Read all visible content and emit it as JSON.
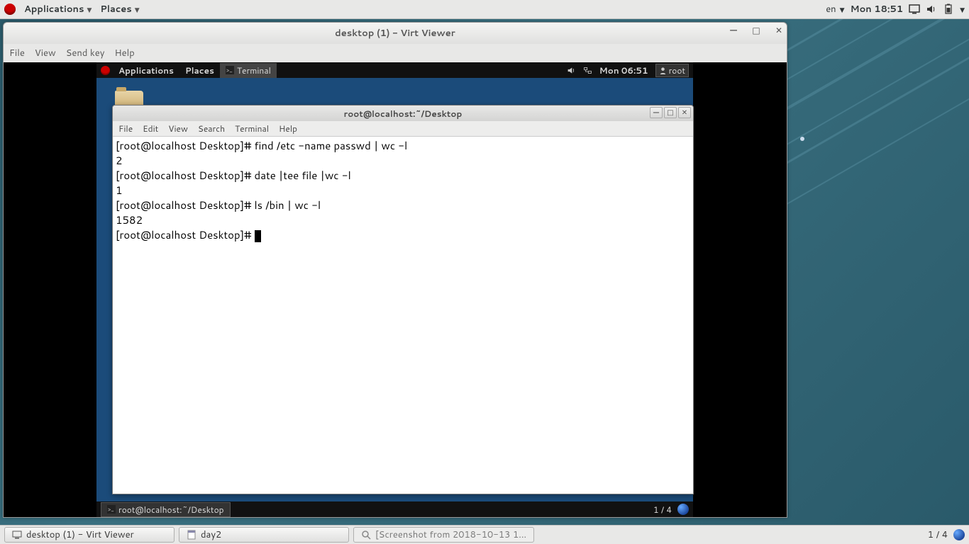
{
  "outer_panel": {
    "applications": "Applications",
    "places": "Places",
    "lang": "en",
    "datetime": "Mon 18:51"
  },
  "virt_viewer": {
    "title": "desktop (1) - Virt Viewer",
    "menu": {
      "file": "File",
      "view": "View",
      "sendkey": "Send key",
      "help": "Help"
    }
  },
  "inner_panel": {
    "applications": "Applications",
    "places": "Places",
    "terminal_tab": "Terminal",
    "datetime": "Mon 06:51",
    "user": "root"
  },
  "terminal": {
    "title": "root@localhost:~/Desktop",
    "menu": {
      "file": "File",
      "edit": "Edit",
      "view": "View",
      "search": "Search",
      "terminal": "Terminal",
      "help": "Help"
    },
    "lines": [
      "[root@localhost Desktop]# find /etc -name passwd | wc -l",
      "2",
      "[root@localhost Desktop]# date |tee file |wc -l",
      "1",
      "[root@localhost Desktop]# ls /bin | wc -l",
      "1582",
      "[root@localhost Desktop]# "
    ]
  },
  "inner_bottom": {
    "task": "root@localhost:~/Desktop",
    "workspace": "1 / 4"
  },
  "outer_taskbar": {
    "task1": "desktop (1) - Virt Viewer",
    "task2": "day2",
    "task3": "[Screenshot from 2018-10-13 1...",
    "workspace": "1 / 4"
  }
}
